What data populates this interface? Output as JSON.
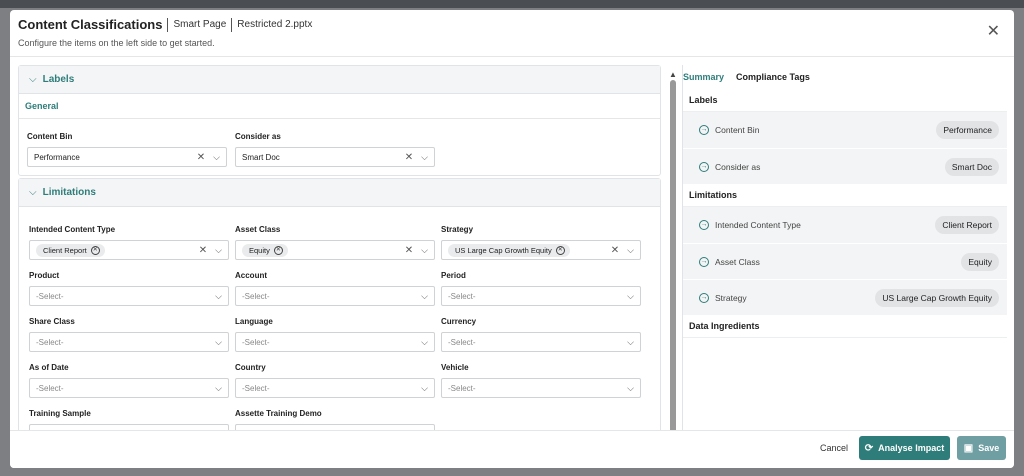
{
  "header": {
    "title": "Content Classifications",
    "crumb1": "Smart Page",
    "crumb2": "Restricted 2.pptx",
    "subtitle": "Configure the items on the left side to get started."
  },
  "labels_section": {
    "title": "Labels",
    "tab": "General",
    "content_bin": {
      "label": "Content Bin",
      "value": "Performance"
    },
    "consider_as": {
      "label": "Consider as",
      "value": "Smart Doc"
    }
  },
  "limitations_section": {
    "title": "Limitations",
    "placeholder": "-Select-",
    "intended_content_type": {
      "label": "Intended Content Type",
      "chips": [
        "Client Report"
      ]
    },
    "asset_class": {
      "label": "Asset Class",
      "chips": [
        "Equity"
      ]
    },
    "strategy": {
      "label": "Strategy",
      "chips": [
        "US Large Cap Growth Equity"
      ]
    },
    "product": {
      "label": "Product"
    },
    "account": {
      "label": "Account"
    },
    "period": {
      "label": "Period"
    },
    "share_class": {
      "label": "Share Class"
    },
    "language": {
      "label": "Language"
    },
    "currency": {
      "label": "Currency"
    },
    "as_of_date": {
      "label": "As of Date"
    },
    "country": {
      "label": "Country"
    },
    "vehicle": {
      "label": "Vehicle"
    },
    "training_sample": {
      "label": "Training Sample"
    },
    "assette_training_demo": {
      "label": "Assette Training Demo"
    }
  },
  "summary": {
    "tabs": [
      "Summary",
      "Compliance Tags"
    ],
    "labels_heading": "Labels",
    "labels_rows": [
      {
        "label": "Content Bin",
        "value": "Performance"
      },
      {
        "label": "Consider as",
        "value": "Smart Doc"
      }
    ],
    "limitations_heading": "Limitations",
    "limitations_rows": [
      {
        "label": "Intended Content Type",
        "value": "Client Report"
      },
      {
        "label": "Asset Class",
        "value": "Equity"
      },
      {
        "label": "Strategy",
        "value": "US Large Cap Growth Equity"
      }
    ],
    "data_heading": "Data Ingredients"
  },
  "footer": {
    "cancel": "Cancel",
    "analyse": "Analyse Impact",
    "save": "Save"
  },
  "colors": {
    "accent": "#2e7d7a",
    "save": "#6f9ea3"
  }
}
